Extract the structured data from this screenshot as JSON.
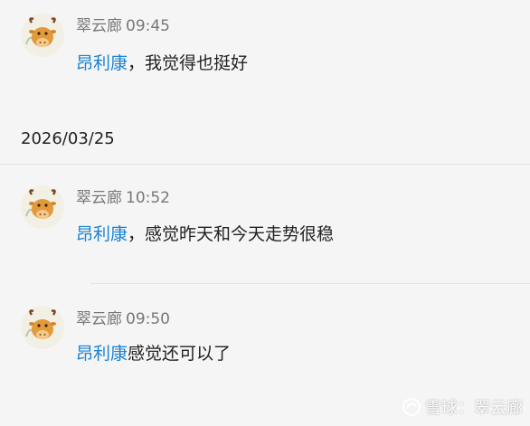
{
  "comments": [
    {
      "author": "翠云廊",
      "time": "09:45",
      "mention": "昂利康",
      "text": "，我觉得也挺好"
    },
    {
      "author": "翠云廊",
      "time": "10:52",
      "mention": "昂利康",
      "text": "，感觉昨天和今天走势很稳"
    },
    {
      "author": "翠云廊",
      "time": "09:50",
      "mention": "昂利康",
      "text": "感觉还可以了"
    }
  ],
  "date_separator": "2026/03/25",
  "watermark": {
    "site": "雪球",
    "separator": "：",
    "user": "翠云廊"
  },
  "colors": {
    "background": "#f5f5f5",
    "mention": "#1a82d2",
    "meta": "#777777",
    "text": "#222222"
  },
  "icons": {
    "avatar": "ox-cartoon-avatar",
    "watermark_logo": "snowball-logo-icon"
  }
}
